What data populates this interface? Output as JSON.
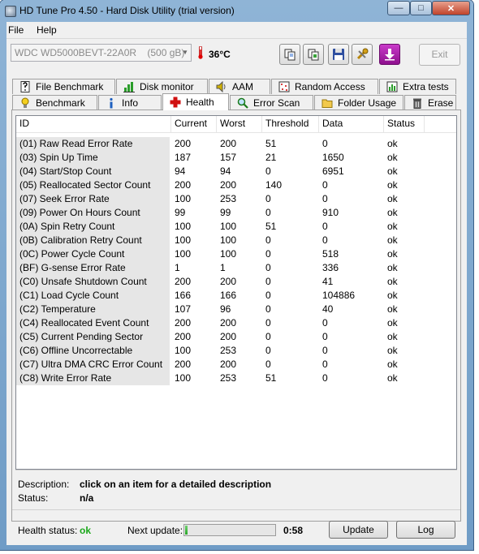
{
  "window": {
    "title": "HD Tune Pro 4.50 - Hard Disk Utility (trial version)"
  },
  "menu": {
    "file": "File",
    "help": "Help"
  },
  "toolbar": {
    "drive": "WDC WD5000BEVT-22A0R    (500 gB)",
    "temperature": "36°C",
    "exit": "Exit"
  },
  "tabs_top": [
    {
      "label": "File Benchmark",
      "icon": "file-benchmark-icon"
    },
    {
      "label": "Disk monitor",
      "icon": "disk-monitor-icon"
    },
    {
      "label": "AAM",
      "icon": "speaker-icon"
    },
    {
      "label": "Random Access",
      "icon": "random-access-icon"
    },
    {
      "label": "Extra tests",
      "icon": "extra-tests-icon"
    }
  ],
  "tabs_bottom": [
    {
      "label": "Benchmark",
      "icon": "lightbulb-icon"
    },
    {
      "label": "Info",
      "icon": "info-icon"
    },
    {
      "label": "Health",
      "icon": "health-cross-icon"
    },
    {
      "label": "Error Scan",
      "icon": "magnifier-icon"
    },
    {
      "label": "Folder Usage",
      "icon": "folder-icon"
    },
    {
      "label": "Erase",
      "icon": "trash-icon"
    }
  ],
  "table": {
    "columns": [
      "ID",
      "Current",
      "Worst",
      "Threshold",
      "Data",
      "Status"
    ],
    "rows": [
      [
        "(01) Raw Read Error Rate",
        "200",
        "200",
        "51",
        "0",
        "ok"
      ],
      [
        "(03) Spin Up Time",
        "187",
        "157",
        "21",
        "1650",
        "ok"
      ],
      [
        "(04) Start/Stop Count",
        "94",
        "94",
        "0",
        "6951",
        "ok"
      ],
      [
        "(05) Reallocated Sector Count",
        "200",
        "200",
        "140",
        "0",
        "ok"
      ],
      [
        "(07) Seek Error Rate",
        "100",
        "253",
        "0",
        "0",
        "ok"
      ],
      [
        "(09) Power On Hours Count",
        "99",
        "99",
        "0",
        "910",
        "ok"
      ],
      [
        "(0A) Spin Retry Count",
        "100",
        "100",
        "51",
        "0",
        "ok"
      ],
      [
        "(0B) Calibration Retry Count",
        "100",
        "100",
        "0",
        "0",
        "ok"
      ],
      [
        "(0C) Power Cycle Count",
        "100",
        "100",
        "0",
        "518",
        "ok"
      ],
      [
        "(BF) G-sense Error Rate",
        "1",
        "1",
        "0",
        "336",
        "ok"
      ],
      [
        "(C0) Unsafe Shutdown Count",
        "200",
        "200",
        "0",
        "41",
        "ok"
      ],
      [
        "(C1) Load Cycle Count",
        "166",
        "166",
        "0",
        "104886",
        "ok"
      ],
      [
        "(C2) Temperature",
        "107",
        "96",
        "0",
        "40",
        "ok"
      ],
      [
        "(C4) Reallocated Event Count",
        "200",
        "200",
        "0",
        "0",
        "ok"
      ],
      [
        "(C5) Current Pending Sector",
        "200",
        "200",
        "0",
        "0",
        "ok"
      ],
      [
        "(C6) Offline Uncorrectable",
        "100",
        "253",
        "0",
        "0",
        "ok"
      ],
      [
        "(C7) Ultra DMA CRC Error Count",
        "200",
        "200",
        "0",
        "0",
        "ok"
      ],
      [
        "(C8) Write Error Rate",
        "100",
        "253",
        "51",
        "0",
        "ok"
      ]
    ]
  },
  "details": {
    "description_label": "Description:",
    "description_value": "click on an item for a detailed description",
    "status_label": "Status:",
    "status_value": "n/a"
  },
  "footer": {
    "health_label": "Health status:",
    "health_value": "ok",
    "next_update_label": "Next update:",
    "countdown": "0:58",
    "progress_fraction": 0.03,
    "update_button": "Update",
    "log_button": "Log"
  },
  "colors": {
    "ok_green": "#1ba81b",
    "title_bar": "#8fb4d6",
    "exit_arrow": "#b01fb0"
  }
}
